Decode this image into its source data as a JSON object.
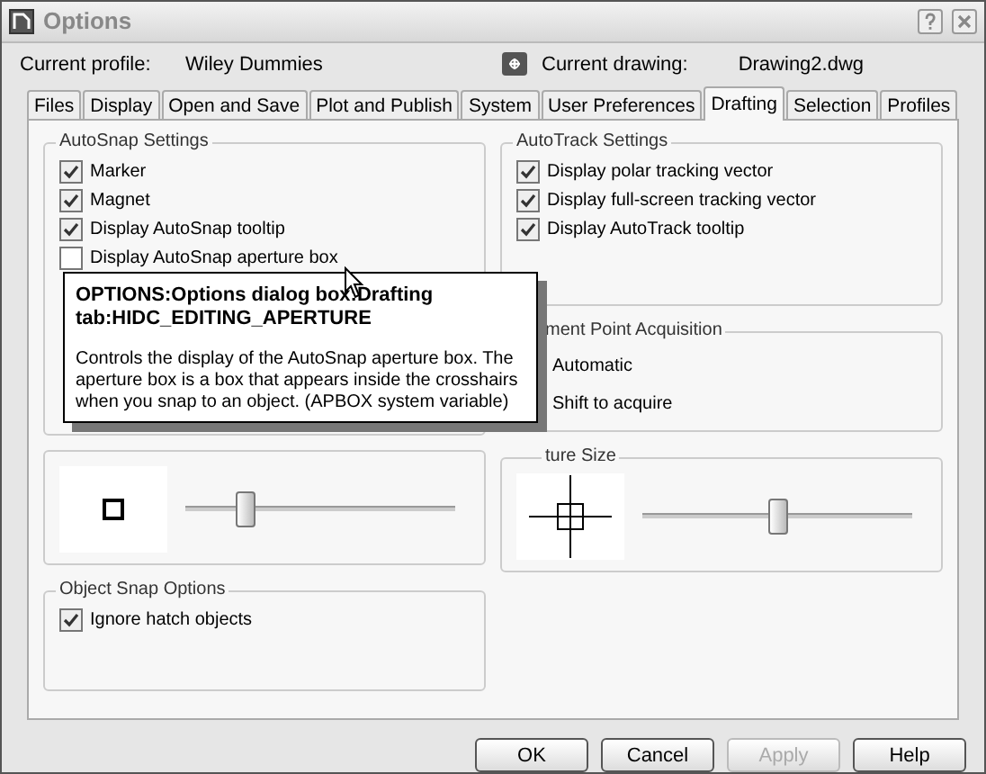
{
  "window": {
    "title": "Options"
  },
  "profile": {
    "label": "Current profile:",
    "value": "Wiley Dummies"
  },
  "drawing": {
    "label": "Current drawing:",
    "value": "Drawing2.dwg"
  },
  "tabs": [
    {
      "label": "Files",
      "selected": false
    },
    {
      "label": "Display",
      "selected": false
    },
    {
      "label": "Open and Save",
      "selected": false
    },
    {
      "label": "Plot and Publish",
      "selected": false
    },
    {
      "label": "System",
      "selected": false
    },
    {
      "label": "User Preferences",
      "selected": false
    },
    {
      "label": "Drafting",
      "selected": true
    },
    {
      "label": "Selection",
      "selected": false
    },
    {
      "label": "Profiles",
      "selected": false
    }
  ],
  "autosnap": {
    "title": "AutoSnap Settings",
    "options": [
      {
        "label": "Marker",
        "checked": true
      },
      {
        "label": "Magnet",
        "checked": true
      },
      {
        "label": "Display AutoSnap tooltip",
        "checked": true
      },
      {
        "label": "Display AutoSnap aperture box",
        "checked": false
      }
    ]
  },
  "autotrack": {
    "title": "AutoTrack Settings",
    "options": [
      {
        "label": "Display polar tracking vector",
        "checked": true
      },
      {
        "label": "Display full-screen tracking vector",
        "checked": true
      },
      {
        "label": "Display AutoTrack tooltip",
        "checked": true
      }
    ]
  },
  "alignment": {
    "title": "ment Point Acquisition",
    "options": [
      "Automatic",
      "Shift to acquire"
    ]
  },
  "marker_size": {
    "level": 0.22
  },
  "aperture_size": {
    "title": "ture Size",
    "level": 0.5
  },
  "object_snap": {
    "title": "Object Snap Options",
    "options": [
      {
        "label": "Ignore hatch objects",
        "checked": true
      }
    ]
  },
  "tooltip": {
    "heading": "OPTIONS:Options dialog box:Drafting tab:HIDC_EDITING_APERTURE",
    "text": "Controls the display of the AutoSnap aperture box. The aperture box is a box that appears inside the crosshairs when you snap to an object. (APBOX system variable)"
  },
  "buttons": [
    {
      "label": "OK",
      "disabled": false
    },
    {
      "label": "Cancel",
      "disabled": false
    },
    {
      "label": "Apply",
      "disabled": true
    },
    {
      "label": "Help",
      "disabled": false
    }
  ]
}
